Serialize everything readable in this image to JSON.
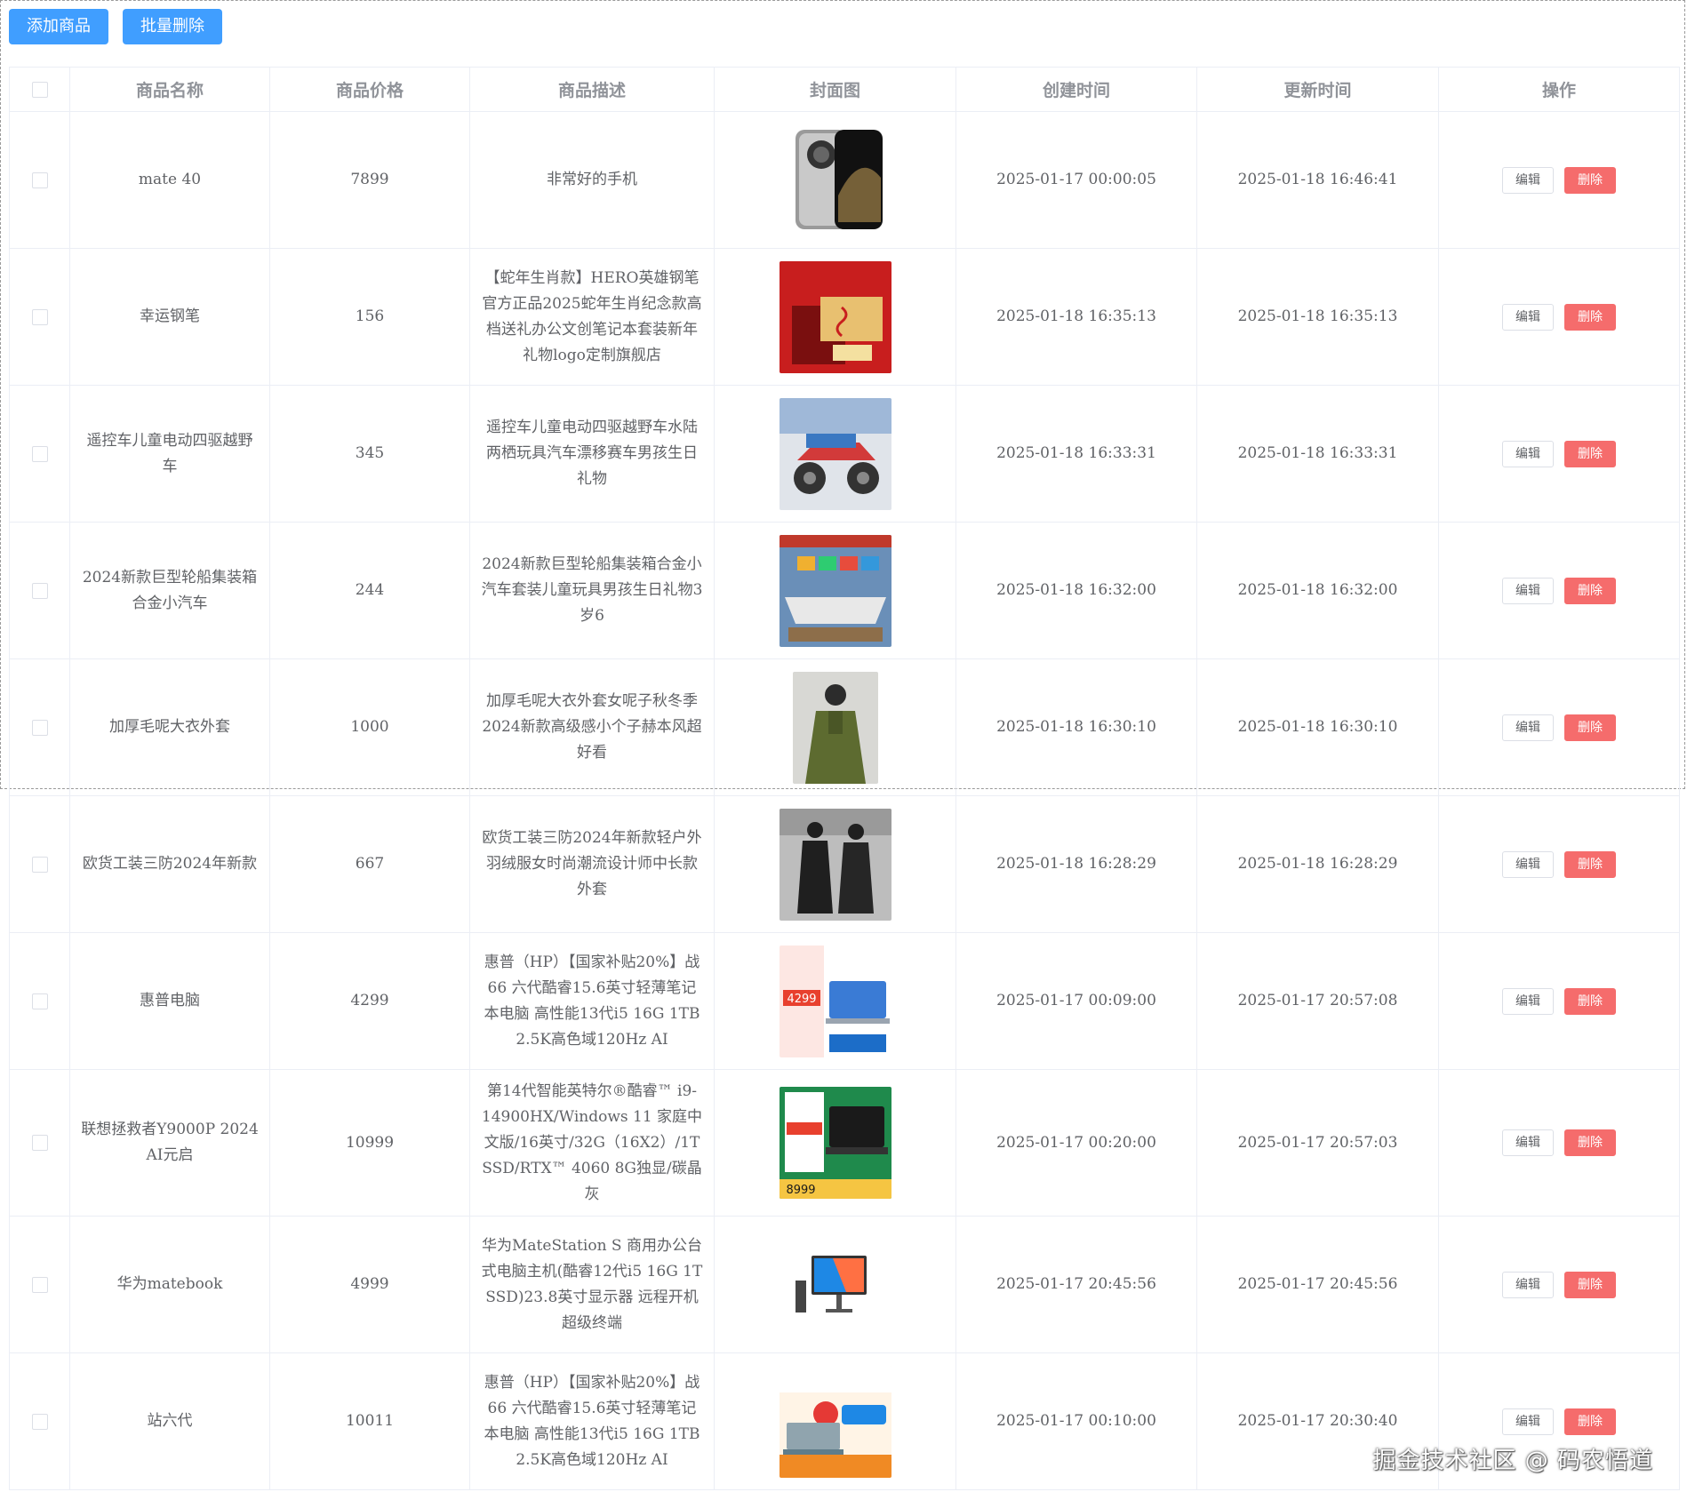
{
  "toolbar": {
    "add_label": "添加商品",
    "batch_delete_label": "批量删除"
  },
  "table": {
    "headers": {
      "name": "商品名称",
      "price": "商品价格",
      "desc": "商品描述",
      "cover": "封面图",
      "created": "创建时间",
      "updated": "更新时间",
      "actions": "操作"
    },
    "edit_label": "编辑",
    "delete_label": "删除",
    "rows": [
      {
        "name": "mate 40",
        "price": "7899",
        "desc": "非常好的手机",
        "created": "2025-01-17 00:00:05",
        "updated": "2025-01-18 16:46:41",
        "cover_icon": "phone-image"
      },
      {
        "name": "幸运钢笔",
        "price": "156",
        "desc": "【蛇年生肖款】HERO英雄钢笔官方正品2025蛇年生肖纪念款高档送礼办公文创笔记本套装新年礼物logo定制旗舰店",
        "created": "2025-01-18 16:35:13",
        "updated": "2025-01-18 16:35:13",
        "cover_icon": "pen-gift-box-image"
      },
      {
        "name": "遥控车儿童电动四驱越野车",
        "price": "345",
        "desc": "遥控车儿童电动四驱越野车水陆两栖玩具汽车漂移赛车男孩生日礼物",
        "created": "2025-01-18 16:33:31",
        "updated": "2025-01-18 16:33:31",
        "cover_icon": "rc-car-image"
      },
      {
        "name": "2024新款巨型轮船集装箱合金小汽车",
        "price": "244",
        "desc": "2024新款巨型轮船集装箱合金小汽车套装儿童玩具男孩生日礼物3岁6",
        "created": "2025-01-18 16:32:00",
        "updated": "2025-01-18 16:32:00",
        "cover_icon": "toy-ship-image"
      },
      {
        "name": "加厚毛呢大衣外套",
        "price": "1000",
        "desc": "加厚毛呢大衣外套女呢子秋冬季2024新款高级感小个子赫本风超好看",
        "created": "2025-01-18 16:30:10",
        "updated": "2025-01-18 16:30:10",
        "cover_icon": "wool-coat-image"
      },
      {
        "name": "欧货工装三防2024年新款",
        "price": "667",
        "desc": "欧货工装三防2024年新款轻户外羽绒服女时尚潮流设计师中长款外套",
        "created": "2025-01-18 16:28:29",
        "updated": "2025-01-18 16:28:29",
        "cover_icon": "down-jacket-image"
      },
      {
        "name": "惠普电脑",
        "price": "4299",
        "desc": "惠普（HP）【国家补贴20%】战66 六代酷睿15.6英寸轻薄笔记本电脑 高性能13代i5 16G 1TB 2.5K高色域120Hz AI",
        "created": "2025-01-17 00:09:00",
        "updated": "2025-01-17 20:57:08",
        "cover_icon": "laptop-image"
      },
      {
        "name": "联想拯救者Y9000P 2024 AI元启",
        "price": "10999",
        "desc": "第14代智能英特尔®酷睿™ i9-14900HX/Windows 11 家庭中文版/16英寸/32G（16X2）/1T SSD/RTX™ 4060 8G独显/碳晶灰",
        "created": "2025-01-17 00:20:00",
        "updated": "2025-01-17 20:57:03",
        "cover_icon": "gaming-laptop-image"
      },
      {
        "name": "华为matebook",
        "price": "4999",
        "desc": "华为MateStation S 商用办公台式电脑主机(酷睿12代i5 16G 1T SSD)23.8英寸显示器 远程开机 超级终端",
        "created": "2025-01-17 20:45:56",
        "updated": "2025-01-17 20:45:56",
        "cover_icon": "desktop-pc-image"
      },
      {
        "name": "站六代",
        "price": "10011",
        "desc": "惠普（HP）【国家补贴20%】战66 六代酷睿15.6英寸轻薄笔记本电脑 高性能13代i5 16G 1TB 2.5K高色域120Hz AI",
        "created": "2025-01-17 00:10:00",
        "updated": "2025-01-17 20:30:40",
        "cover_icon": "laptop-promo-image"
      }
    ]
  },
  "cover_images": {
    "row0": {
      "text": "",
      "colors": [
        "#f0f0f0",
        "#8a8a8a",
        "#1a1a1a",
        "#c9a25a"
      ]
    },
    "row1": {
      "text": "",
      "colors": [
        "#c81e1e",
        "#e8c070",
        "#7a0f0f"
      ]
    },
    "row2": {
      "text": "",
      "colors": [
        "#3a78c2",
        "#d23a3a",
        "#e0e4ea",
        "#444"
      ]
    },
    "row3": {
      "text": "",
      "colors": [
        "#6a8fb8",
        "#e8e8e8",
        "#c0392b",
        "#f0b030"
      ]
    },
    "row4": {
      "text": "",
      "colors": [
        "#d8d8d4",
        "#5d6b30",
        "#2c2c2c"
      ]
    },
    "row5": {
      "text": "",
      "colors": [
        "#bdbdbd",
        "#1f1f1f",
        "#707070"
      ]
    },
    "row6": {
      "text": "4299",
      "colors": [
        "#ffffff",
        "#e8402e",
        "#3a7bd5",
        "#1c6dc8"
      ]
    },
    "row7": {
      "text": "8999",
      "colors": [
        "#1f8a4c",
        "#e8402e",
        "#1a1a1a",
        "#f5c542"
      ]
    },
    "row8": {
      "text": "",
      "colors": [
        "#ffffff",
        "#1e88e5",
        "#ff7043",
        "#333"
      ]
    },
    "row9": {
      "text": "",
      "colors": [
        "#ffffff",
        "#f08a24",
        "#e53935",
        "#1e88e5"
      ]
    }
  },
  "watermark": "掘金技术社区 @ 码农悟道"
}
